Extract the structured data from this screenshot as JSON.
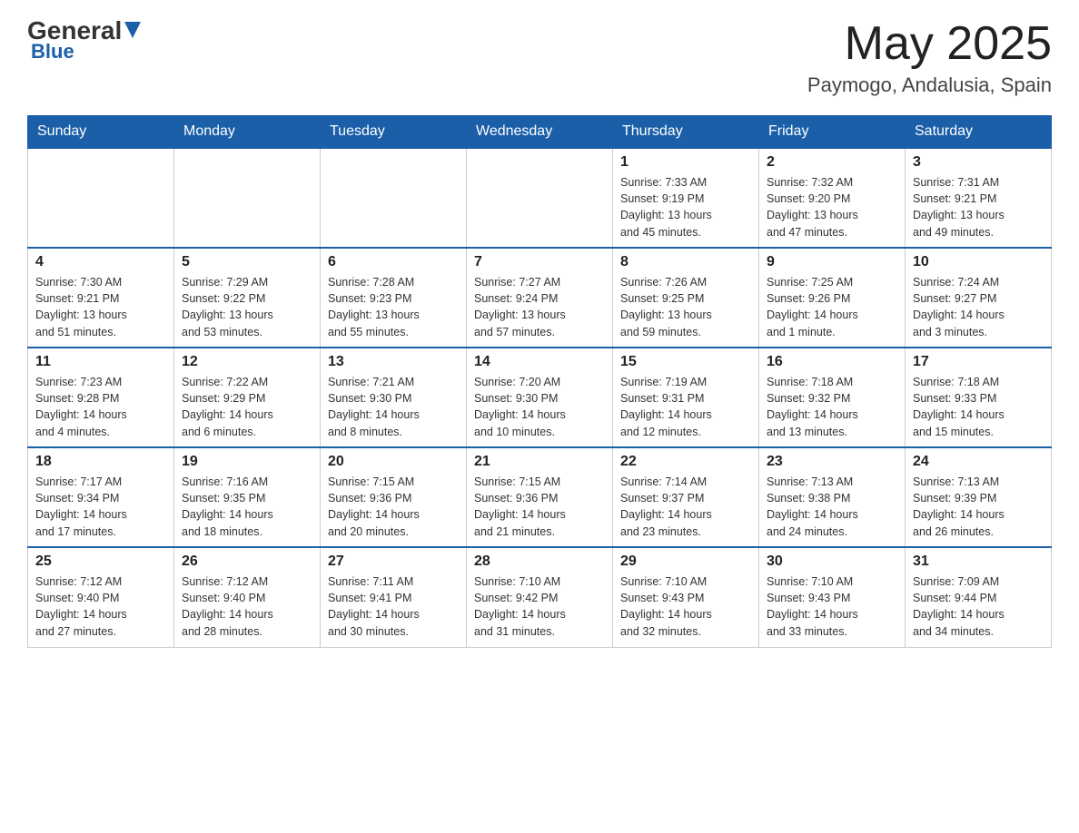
{
  "header": {
    "logo_general": "General",
    "logo_blue": "Blue",
    "month_title": "May 2025",
    "location": "Paymogo, Andalusia, Spain"
  },
  "weekdays": [
    "Sunday",
    "Monday",
    "Tuesday",
    "Wednesday",
    "Thursday",
    "Friday",
    "Saturday"
  ],
  "weeks": [
    [
      {
        "day": "",
        "info": ""
      },
      {
        "day": "",
        "info": ""
      },
      {
        "day": "",
        "info": ""
      },
      {
        "day": "",
        "info": ""
      },
      {
        "day": "1",
        "info": "Sunrise: 7:33 AM\nSunset: 9:19 PM\nDaylight: 13 hours\nand 45 minutes."
      },
      {
        "day": "2",
        "info": "Sunrise: 7:32 AM\nSunset: 9:20 PM\nDaylight: 13 hours\nand 47 minutes."
      },
      {
        "day": "3",
        "info": "Sunrise: 7:31 AM\nSunset: 9:21 PM\nDaylight: 13 hours\nand 49 minutes."
      }
    ],
    [
      {
        "day": "4",
        "info": "Sunrise: 7:30 AM\nSunset: 9:21 PM\nDaylight: 13 hours\nand 51 minutes."
      },
      {
        "day": "5",
        "info": "Sunrise: 7:29 AM\nSunset: 9:22 PM\nDaylight: 13 hours\nand 53 minutes."
      },
      {
        "day": "6",
        "info": "Sunrise: 7:28 AM\nSunset: 9:23 PM\nDaylight: 13 hours\nand 55 minutes."
      },
      {
        "day": "7",
        "info": "Sunrise: 7:27 AM\nSunset: 9:24 PM\nDaylight: 13 hours\nand 57 minutes."
      },
      {
        "day": "8",
        "info": "Sunrise: 7:26 AM\nSunset: 9:25 PM\nDaylight: 13 hours\nand 59 minutes."
      },
      {
        "day": "9",
        "info": "Sunrise: 7:25 AM\nSunset: 9:26 PM\nDaylight: 14 hours\nand 1 minute."
      },
      {
        "day": "10",
        "info": "Sunrise: 7:24 AM\nSunset: 9:27 PM\nDaylight: 14 hours\nand 3 minutes."
      }
    ],
    [
      {
        "day": "11",
        "info": "Sunrise: 7:23 AM\nSunset: 9:28 PM\nDaylight: 14 hours\nand 4 minutes."
      },
      {
        "day": "12",
        "info": "Sunrise: 7:22 AM\nSunset: 9:29 PM\nDaylight: 14 hours\nand 6 minutes."
      },
      {
        "day": "13",
        "info": "Sunrise: 7:21 AM\nSunset: 9:30 PM\nDaylight: 14 hours\nand 8 minutes."
      },
      {
        "day": "14",
        "info": "Sunrise: 7:20 AM\nSunset: 9:30 PM\nDaylight: 14 hours\nand 10 minutes."
      },
      {
        "day": "15",
        "info": "Sunrise: 7:19 AM\nSunset: 9:31 PM\nDaylight: 14 hours\nand 12 minutes."
      },
      {
        "day": "16",
        "info": "Sunrise: 7:18 AM\nSunset: 9:32 PM\nDaylight: 14 hours\nand 13 minutes."
      },
      {
        "day": "17",
        "info": "Sunrise: 7:18 AM\nSunset: 9:33 PM\nDaylight: 14 hours\nand 15 minutes."
      }
    ],
    [
      {
        "day": "18",
        "info": "Sunrise: 7:17 AM\nSunset: 9:34 PM\nDaylight: 14 hours\nand 17 minutes."
      },
      {
        "day": "19",
        "info": "Sunrise: 7:16 AM\nSunset: 9:35 PM\nDaylight: 14 hours\nand 18 minutes."
      },
      {
        "day": "20",
        "info": "Sunrise: 7:15 AM\nSunset: 9:36 PM\nDaylight: 14 hours\nand 20 minutes."
      },
      {
        "day": "21",
        "info": "Sunrise: 7:15 AM\nSunset: 9:36 PM\nDaylight: 14 hours\nand 21 minutes."
      },
      {
        "day": "22",
        "info": "Sunrise: 7:14 AM\nSunset: 9:37 PM\nDaylight: 14 hours\nand 23 minutes."
      },
      {
        "day": "23",
        "info": "Sunrise: 7:13 AM\nSunset: 9:38 PM\nDaylight: 14 hours\nand 24 minutes."
      },
      {
        "day": "24",
        "info": "Sunrise: 7:13 AM\nSunset: 9:39 PM\nDaylight: 14 hours\nand 26 minutes."
      }
    ],
    [
      {
        "day": "25",
        "info": "Sunrise: 7:12 AM\nSunset: 9:40 PM\nDaylight: 14 hours\nand 27 minutes."
      },
      {
        "day": "26",
        "info": "Sunrise: 7:12 AM\nSunset: 9:40 PM\nDaylight: 14 hours\nand 28 minutes."
      },
      {
        "day": "27",
        "info": "Sunrise: 7:11 AM\nSunset: 9:41 PM\nDaylight: 14 hours\nand 30 minutes."
      },
      {
        "day": "28",
        "info": "Sunrise: 7:10 AM\nSunset: 9:42 PM\nDaylight: 14 hours\nand 31 minutes."
      },
      {
        "day": "29",
        "info": "Sunrise: 7:10 AM\nSunset: 9:43 PM\nDaylight: 14 hours\nand 32 minutes."
      },
      {
        "day": "30",
        "info": "Sunrise: 7:10 AM\nSunset: 9:43 PM\nDaylight: 14 hours\nand 33 minutes."
      },
      {
        "day": "31",
        "info": "Sunrise: 7:09 AM\nSunset: 9:44 PM\nDaylight: 14 hours\nand 34 minutes."
      }
    ]
  ]
}
